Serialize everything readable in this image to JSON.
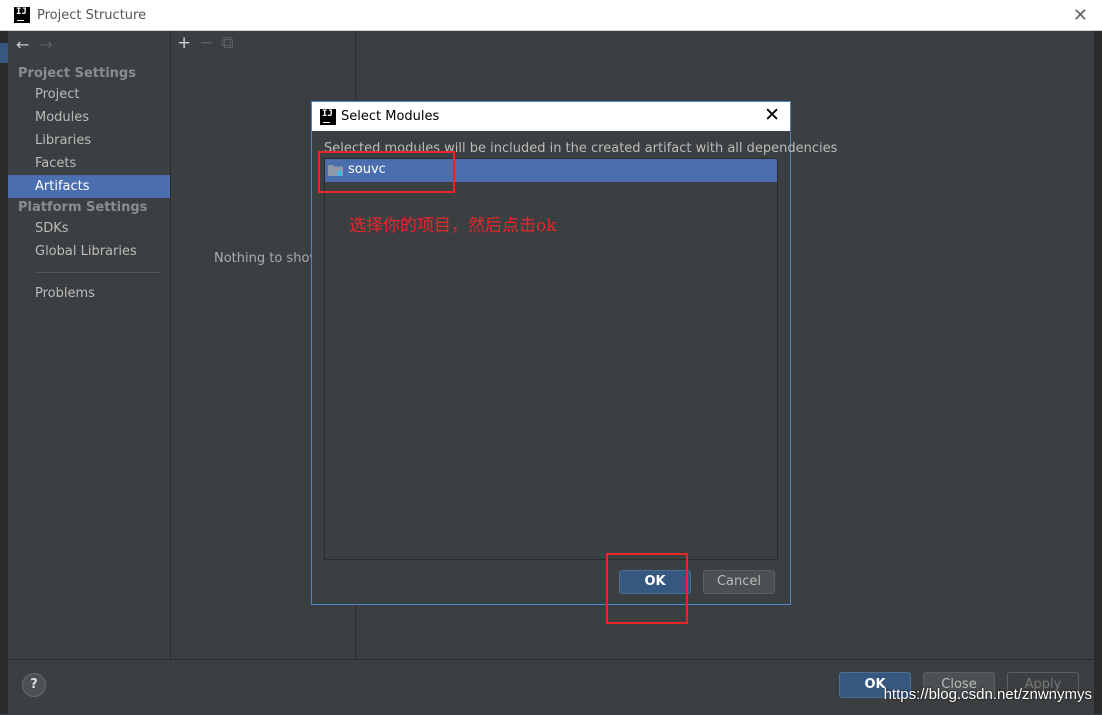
{
  "window": {
    "title": "Project Structure",
    "close_glyph": "✕",
    "logo_text": "IJ"
  },
  "nav": {
    "back": "←",
    "forward": "→"
  },
  "sidebar": {
    "sections": [
      {
        "heading": "Project Settings",
        "items": [
          "Project",
          "Modules",
          "Libraries",
          "Facets",
          "Artifacts"
        ]
      },
      {
        "heading": "Platform Settings",
        "items": [
          "SDKs",
          "Global Libraries"
        ]
      }
    ],
    "problems": "Problems",
    "selected": "Artifacts"
  },
  "middle": {
    "add": "+",
    "remove": "−",
    "copy": "⧉",
    "empty_text": "Nothing to show"
  },
  "footer": {
    "help": "?",
    "ok": "OK",
    "close": "Close",
    "apply": "Apply"
  },
  "dialog": {
    "title": "Select Modules",
    "close_glyph": "✕",
    "description": "Selected modules will be included in the created artifact with all dependencies",
    "modules": [
      {
        "name": "souvc",
        "selected": true
      }
    ],
    "ok": "OK",
    "cancel": "Cancel"
  },
  "annotation": {
    "text": "选择你的项目，然后点击ok",
    "color": "#e8262a"
  },
  "watermark": "https://blog.csdn.net/znwnymys",
  "colors": {
    "selection": "#4b6eaf",
    "background": "#3c3f41",
    "accent_button": "#365880",
    "dialog_border": "#4a88c7"
  }
}
